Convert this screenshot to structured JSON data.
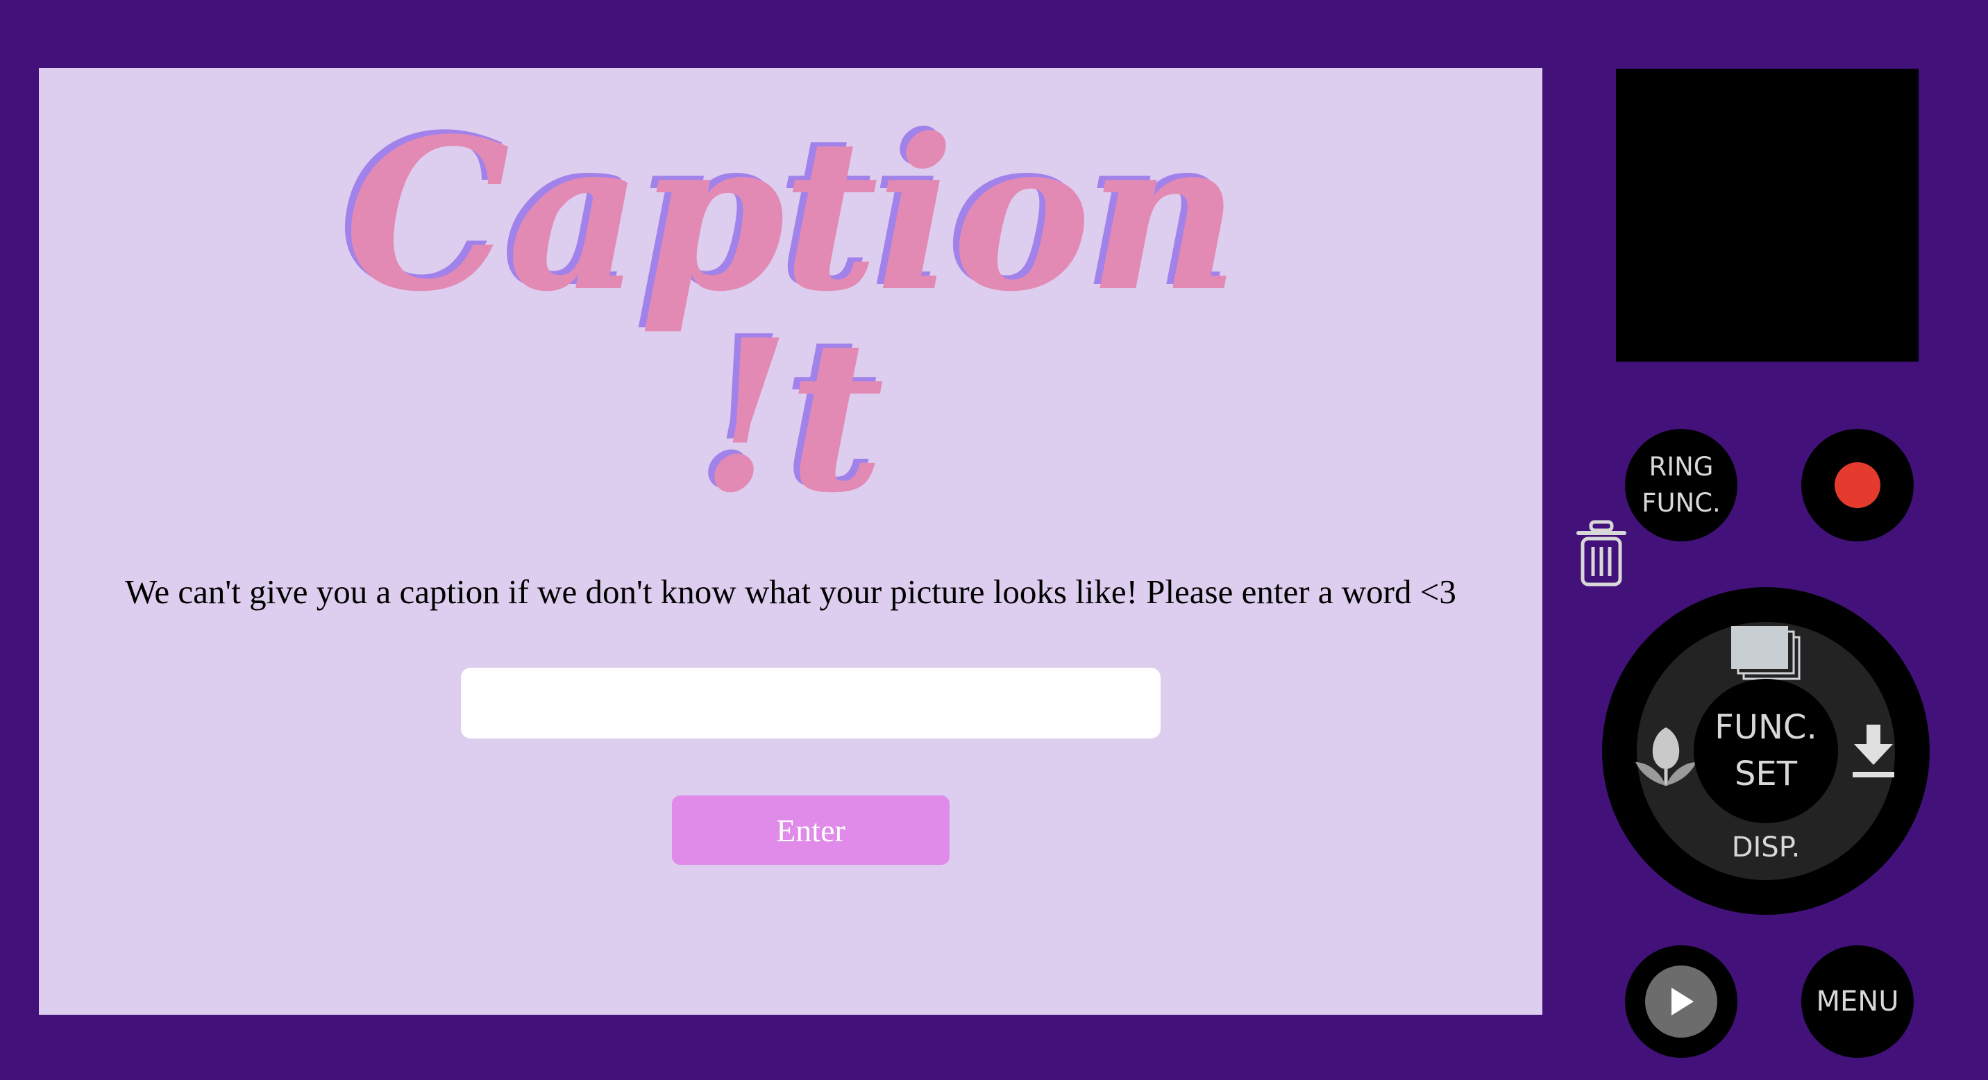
{
  "app": {
    "title_line1": "Caption",
    "title_line2": "!t",
    "message": "We can't give you a caption if we don't know what your picture looks like! Please enter a word <3",
    "input_value": "",
    "input_placeholder": "",
    "enter_label": "Enter"
  },
  "camera": {
    "ring_func_line1": "RING",
    "ring_func_line2": "FUNC.",
    "func_set_line1": "FUNC.",
    "func_set_line2": "SET",
    "disp_label": "DISP.",
    "menu_label": "MENU",
    "icons": [
      "trash-icon",
      "record-icon",
      "stack-icon",
      "macro-flower-icon",
      "download-icon",
      "play-icon"
    ]
  },
  "colors": {
    "background": "#43117a",
    "screen": "#ddcdee",
    "title_fill": "#e28ab3",
    "title_shadow": "#a182ea",
    "button": "#e08be9",
    "record": "#e43b2e"
  }
}
